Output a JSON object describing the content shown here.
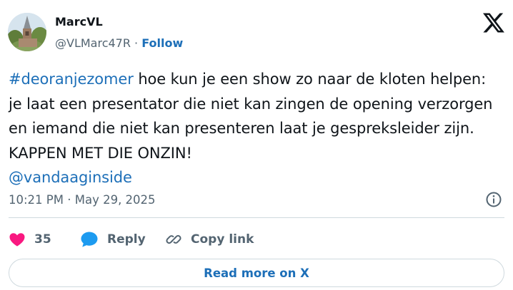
{
  "author": {
    "name": "MarcVL",
    "handle": "@VLMarc47R",
    "separator": " · ",
    "follow_label": "Follow",
    "avatar_icon": "church-tower-photo"
  },
  "logo_icon": "x-logo-icon",
  "tweet": {
    "hashtag": "#deoranjezomer",
    "body": " hoe kun je een show zo naar de kloten helpen: je laat een presentator die niet kan zingen de opening verzorgen en iemand die niet kan presenteren laat je gespreksleider zijn. KAPPEN MET DIE ONZIN!",
    "mention": "@vandaaginside"
  },
  "meta": {
    "timestamp": "10:21 PM · May 29, 2025",
    "info_icon": "info-icon"
  },
  "actions": {
    "like_count": "35",
    "reply_label": "Reply",
    "copy_label": "Copy link"
  },
  "read_more_label": "Read more on X",
  "colors": {
    "link": "#1d6fb8",
    "muted": "#536471",
    "text": "#0f1419",
    "like": "#f91880",
    "reply_bubble": "#1d9bf0",
    "border": "#cfd9de"
  }
}
